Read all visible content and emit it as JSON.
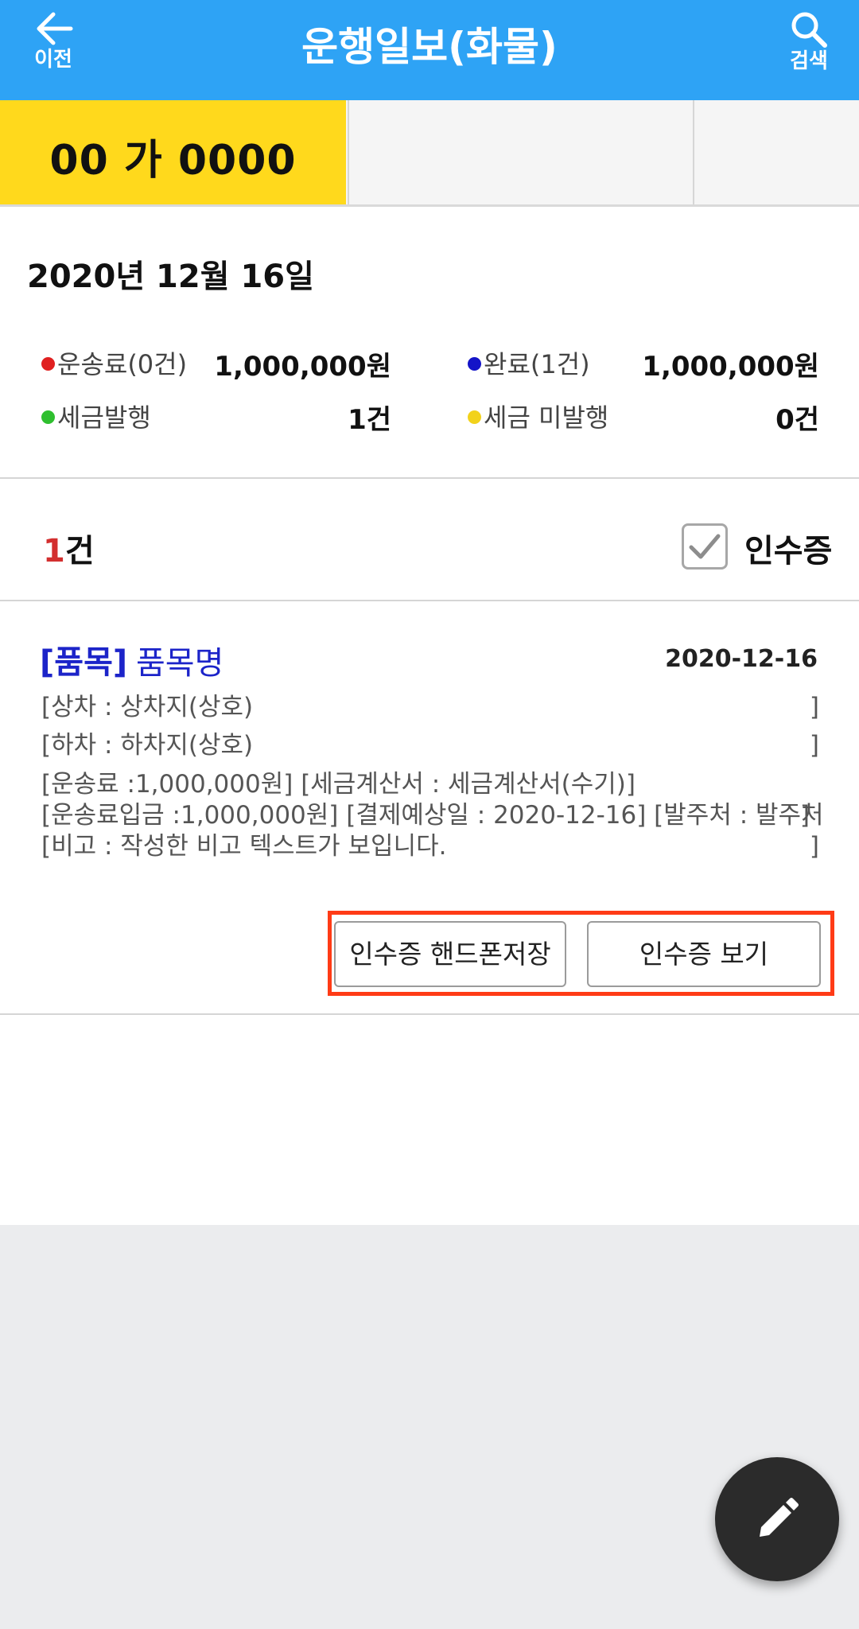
{
  "header": {
    "back_label": "이전",
    "title": "운행일보(화물)",
    "search_label": "검색"
  },
  "tabs": [
    {
      "label": "00 가 0000",
      "active": true
    },
    {
      "label": ""
    },
    {
      "label": ""
    }
  ],
  "summary": {
    "date": "2020년 12월 16일",
    "items": [
      {
        "label": "운송료(0건)",
        "value": "1,000,000원",
        "dot_color": "#e02020"
      },
      {
        "label": "완료(1건)",
        "value": "1,000,000원",
        "dot_color": "#1414c8"
      },
      {
        "label": "세금발행",
        "value": "1건",
        "dot_color": "#2fbf2f"
      },
      {
        "label": "세금 미발행",
        "value": "0건",
        "dot_color": "#f2d21b"
      }
    ]
  },
  "list_header": {
    "count_number": "1",
    "count_suffix": "건",
    "receipt_checkbox_label": "인수증",
    "receipt_checked": true
  },
  "record": {
    "tag": "[품목]",
    "name": "품목명",
    "date": "2020-12-16",
    "lines": [
      {
        "text": "[상차 : 상차지(상호)",
        "end": "]"
      },
      {
        "text": "[하차 : 하차지(상호)",
        "end": "]"
      },
      {
        "text": "[운송료 :1,000,000원] [세금계산서 : 세금계산서(수기)]",
        "end": ""
      },
      {
        "text": "[운송료입금 :1,000,000원] [결제예상일 : 2020-12-16] [발주처 : 발주처",
        "end": "]"
      },
      {
        "text": "[비고 : 작성한 비고 텍스트가 보입니다.",
        "end": "]"
      }
    ],
    "save_button": "인수증 핸드폰저장",
    "view_button": "인수증 보기"
  },
  "colors": {
    "header_bg": "#2ea3f5",
    "active_tab": "#ffd91c",
    "item_blue": "#1c24c9",
    "highlight": "#ff3b16"
  }
}
